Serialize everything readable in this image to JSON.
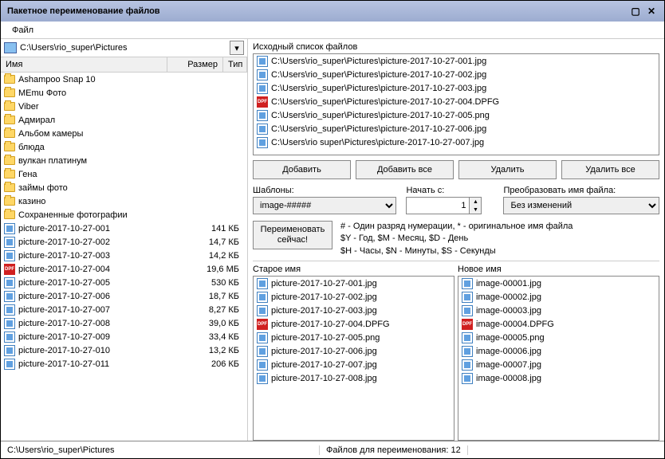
{
  "title": "Пакетное переименование файлов",
  "menu": {
    "file": "Файл"
  },
  "path": "C:\\Users\\rio_super\\Pictures",
  "columns": {
    "name": "Имя",
    "size": "Размер",
    "type": "Тип"
  },
  "folders": [
    "Ashampoo Snap 10",
    "MEmu Фото",
    "Viber",
    "Адмирал",
    "Альбом камеры",
    "блюда",
    "вулкан платинум",
    "Гена",
    "займы фото",
    "казино",
    "Сохраненные фотографии"
  ],
  "files": [
    {
      "name": "picture-2017-10-27-001",
      "size": "141 КБ",
      "kind": "jpg"
    },
    {
      "name": "picture-2017-10-27-002",
      "size": "14,7 КБ",
      "kind": "jpg"
    },
    {
      "name": "picture-2017-10-27-003",
      "size": "14,2 КБ",
      "kind": "jpg"
    },
    {
      "name": "picture-2017-10-27-004",
      "size": "19,6 МБ",
      "kind": "dpf"
    },
    {
      "name": "picture-2017-10-27-005",
      "size": "530 КБ",
      "kind": "jpg"
    },
    {
      "name": "picture-2017-10-27-006",
      "size": "18,7 КБ",
      "kind": "jpg"
    },
    {
      "name": "picture-2017-10-27-007",
      "size": "8,27 КБ",
      "kind": "jpg"
    },
    {
      "name": "picture-2017-10-27-008",
      "size": "39,0 КБ",
      "kind": "jpg"
    },
    {
      "name": "picture-2017-10-27-009",
      "size": "33,4 КБ",
      "kind": "jpg"
    },
    {
      "name": "picture-2017-10-27-010",
      "size": "13,2 КБ",
      "kind": "jpg"
    },
    {
      "name": "picture-2017-10-27-011",
      "size": "206 КБ",
      "kind": "jpg"
    }
  ],
  "srclabel": "Исходный список файлов",
  "srclist": [
    {
      "path": "C:\\Users\\rio_super\\Pictures\\picture-2017-10-27-001.jpg",
      "kind": "jpg"
    },
    {
      "path": "C:\\Users\\rio_super\\Pictures\\picture-2017-10-27-002.jpg",
      "kind": "jpg"
    },
    {
      "path": "C:\\Users\\rio_super\\Pictures\\picture-2017-10-27-003.jpg",
      "kind": "jpg"
    },
    {
      "path": "C:\\Users\\rio_super\\Pictures\\picture-2017-10-27-004.DPFG",
      "kind": "dpf"
    },
    {
      "path": "C:\\Users\\rio_super\\Pictures\\picture-2017-10-27-005.png",
      "kind": "jpg"
    },
    {
      "path": "C:\\Users\\rio_super\\Pictures\\picture-2017-10-27-006.jpg",
      "kind": "jpg"
    },
    {
      "path": "C:\\Users\\rio  super\\Pictures\\picture-2017-10-27-007.jpg",
      "kind": "jpg"
    }
  ],
  "buttons": {
    "add": "Добавить",
    "addAll": "Добавить все",
    "del": "Удалить",
    "delAll": "Удалить все"
  },
  "opts": {
    "templatesLabel": "Шаблоны:",
    "templateValue": "image-#####",
    "startLabel": "Начать с:",
    "startValue": "1",
    "caseLabel": "Преобразовать имя файла:",
    "caseValue": "Без изменений"
  },
  "renameNow": "Переименовать сейчас!",
  "legend1": "# - Один разряд нумерации, * - оригинальное имя файла",
  "legend2": "$Y - Год, $M - Месяц, $D - День",
  "legend3": "$H - Часы, $N - Минуты, $S - Секунды",
  "preview": {
    "oldLabel": "Старое имя",
    "newLabel": "Новое имя",
    "old": [
      {
        "name": "picture-2017-10-27-001.jpg",
        "kind": "jpg"
      },
      {
        "name": "picture-2017-10-27-002.jpg",
        "kind": "jpg"
      },
      {
        "name": "picture-2017-10-27-003.jpg",
        "kind": "jpg"
      },
      {
        "name": "picture-2017-10-27-004.DPFG",
        "kind": "dpf"
      },
      {
        "name": "picture-2017-10-27-005.png",
        "kind": "jpg"
      },
      {
        "name": "picture-2017-10-27-006.jpg",
        "kind": "jpg"
      },
      {
        "name": "picture-2017-10-27-007.jpg",
        "kind": "jpg"
      },
      {
        "name": "picture-2017-10-27-008.jpg",
        "kind": "jpg"
      }
    ],
    "new": [
      {
        "name": "image-00001.jpg",
        "kind": "jpg"
      },
      {
        "name": "image-00002.jpg",
        "kind": "jpg"
      },
      {
        "name": "image-00003.jpg",
        "kind": "jpg"
      },
      {
        "name": "image-00004.DPFG",
        "kind": "dpf"
      },
      {
        "name": "image-00005.png",
        "kind": "jpg"
      },
      {
        "name": "image-00006.jpg",
        "kind": "jpg"
      },
      {
        "name": "image-00007.jpg",
        "kind": "jpg"
      },
      {
        "name": "image-00008.jpg",
        "kind": "jpg"
      }
    ]
  },
  "status": {
    "path": "C:\\Users\\rio_super\\Pictures",
    "count": "Файлов для переименования: 12"
  }
}
